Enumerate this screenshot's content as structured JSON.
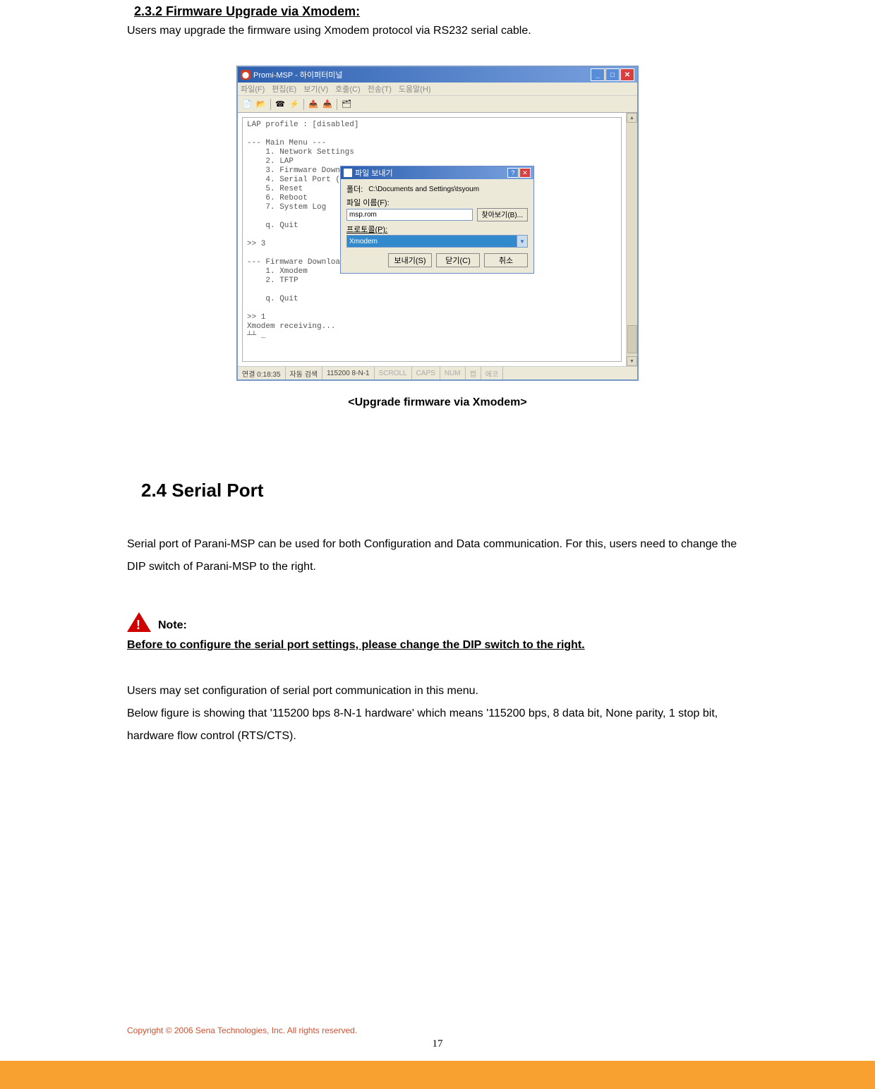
{
  "doc": {
    "section_heading": "2.3.2 Firmware Upgrade via Xmodem:",
    "intro_text": "Users may upgrade the firmware using Xmodem protocol via RS232 serial cable.",
    "fig_caption": "<Upgrade firmware via Xmodem>",
    "section_large": "2.4 Serial Port",
    "paragraph1": "Serial port of Parani-MSP can be used for both Configuration and Data communication. For this, users need to change the DIP switch of Parani-MSP to the right.",
    "note_label": "Note:",
    "note_underline": "Before to configure the serial port settings, please change the DIP switch to the right.",
    "paragraph2_l1": "Users may set configuration of serial port communication in this menu.",
    "paragraph2_l2": "Below figure is showing that '115200 bps 8-N-1 hardware' which means '115200 bps, 8 data bit, None parity, 1 stop bit, hardware flow control (RTS/CTS).",
    "copyright": "Copyright © 2006 Sena Technologies, Inc. All rights reserved.",
    "page_number": "17"
  },
  "window": {
    "title": "Promi-MSP - 하이퍼터미널",
    "menubar": [
      "파일(F)",
      "편집(E)",
      "보기(V)",
      "호출(C)",
      "전송(T)",
      "도움말(H)"
    ],
    "toolbar_icons": [
      "new-doc-icon",
      "open-icon",
      "phone-icon",
      "phone-hang-icon",
      "send-icon",
      "receive-icon",
      "properties-icon"
    ],
    "terminal_text": "LAP profile : [disabled]\n\n--- Main Menu ---\n    1. Network Settings\n    2. LAP\n    3. Firmware Download\n    4. Serial Port (F\n    5. Reset\n    6. Reboot\n    7. System Log\n\n    q. Quit\n\n>> 3\n\n--- Firmware Download ---\n    1. Xmodem\n    2. TFTP\n\n    q. Quit\n\n>> 1\nXmodem receiving...\n┴┴ _",
    "status": {
      "pane1": "연결 0:18:35",
      "pane2": "자동 검색",
      "pane3": "115200 8-N-1",
      "pane4": "SCROLL",
      "pane5": "CAPS",
      "pane6": "NUM",
      "pane7": "캡",
      "pane8": "에코"
    }
  },
  "dialog": {
    "title": "파일 보내기",
    "folder_label": "폴더:",
    "folder_value": "C:\\Documents and Settings\\tsyoum",
    "filename_label": "파일 이름(F):",
    "filename_value": "msp.rom",
    "browse_btn": "찾아보기(B)...",
    "protocol_label": "프로토콜(P):",
    "protocol_value": "Xmodem",
    "send_btn": "보내기(S)",
    "close_btn": "닫기(C)",
    "cancel_btn": "취소"
  }
}
